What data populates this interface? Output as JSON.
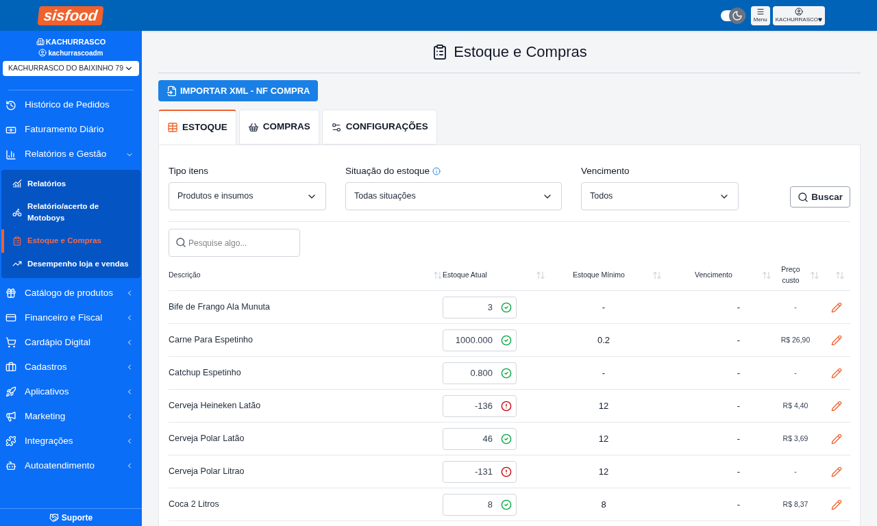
{
  "header": {
    "logo": "sisfood",
    "menu_button": "Menu",
    "user_button": "KACHURRASCO",
    "dark_mode": true
  },
  "sidebar": {
    "store": "KACHURRASCO",
    "user": "kachurrascoadm",
    "store_select": "KACHURRASCO DO BAIXINHO 79",
    "items": [
      {
        "label": "Histórico de Pedidos"
      },
      {
        "label": "Faturamento Diário"
      },
      {
        "label": "Relatórios e Gestão",
        "expanded": true,
        "children": [
          {
            "label": "Relatórios",
            "selected": false
          },
          {
            "label": "Relatório/acerto de Motoboys",
            "selected": false
          },
          {
            "label": "Estoque e Compras",
            "selected": true
          },
          {
            "label": "Desempenho loja e vendas",
            "selected": false
          }
        ]
      },
      {
        "label": "Catálogo de produtos",
        "expanded": false
      },
      {
        "label": "Financeiro e Fiscal",
        "expanded": false
      },
      {
        "label": "Cardápio Digital",
        "expanded": false
      },
      {
        "label": "Cadastros",
        "expanded": false
      },
      {
        "label": "Aplicativos",
        "expanded": false
      },
      {
        "label": "Marketing",
        "expanded": false
      },
      {
        "label": "Integrações",
        "expanded": false
      },
      {
        "label": "Autoatendimento",
        "expanded": false
      }
    ],
    "support": "Suporte"
  },
  "page": {
    "title": "Estoque e Compras",
    "import_button": "IMPORTAR XML - NF COMPRA",
    "tabs": [
      {
        "label": "ESTOQUE",
        "selected": true
      },
      {
        "label": "COMPRAS",
        "selected": false
      },
      {
        "label": "CONFIGURAÇÕES",
        "selected": false
      }
    ],
    "filters": [
      {
        "label": "Tipo itens",
        "value": "Produtos e insumos"
      },
      {
        "label": "Situação do estoque",
        "value": "Todas situações",
        "info": true
      },
      {
        "label": "Vencimento",
        "value": "Todos"
      }
    ],
    "search_button": "Buscar",
    "search": {
      "placeholder": "Pesquise algo..."
    },
    "table": {
      "columns": [
        "Descrição",
        "Estoque Atual",
        "Estoque Mínimo",
        "Vencimento",
        "Preço custo"
      ],
      "rows": [
        {
          "description": "Bife de Frango Ala Munuta",
          "stock": "3",
          "stock_ok": true,
          "minimum": "-",
          "expiry": "-",
          "cost": "-"
        },
        {
          "description": "Carne Para Espetinho",
          "stock": "1000.000",
          "stock_ok": true,
          "minimum": "0.2",
          "expiry": "-",
          "cost": "R$ 26,90"
        },
        {
          "description": "Catchup Espetinho",
          "stock": "0.800",
          "stock_ok": true,
          "minimum": "-",
          "expiry": "-",
          "cost": "-"
        },
        {
          "description": "Cerveja Heineken Latão",
          "stock": "-136",
          "stock_ok": false,
          "minimum": "12",
          "expiry": "-",
          "cost": "R$ 4,40"
        },
        {
          "description": "Cerveja Polar Latão",
          "stock": "46",
          "stock_ok": true,
          "minimum": "12",
          "expiry": "-",
          "cost": "R$ 3,69"
        },
        {
          "description": "Cerveja Polar Litrao",
          "stock": "-131",
          "stock_ok": false,
          "minimum": "12",
          "expiry": "-",
          "cost": "-"
        },
        {
          "description": "Coca 2 Litros",
          "stock": "8",
          "stock_ok": true,
          "minimum": "8",
          "expiry": "-",
          "cost": "R$ 8,37"
        }
      ]
    }
  }
}
